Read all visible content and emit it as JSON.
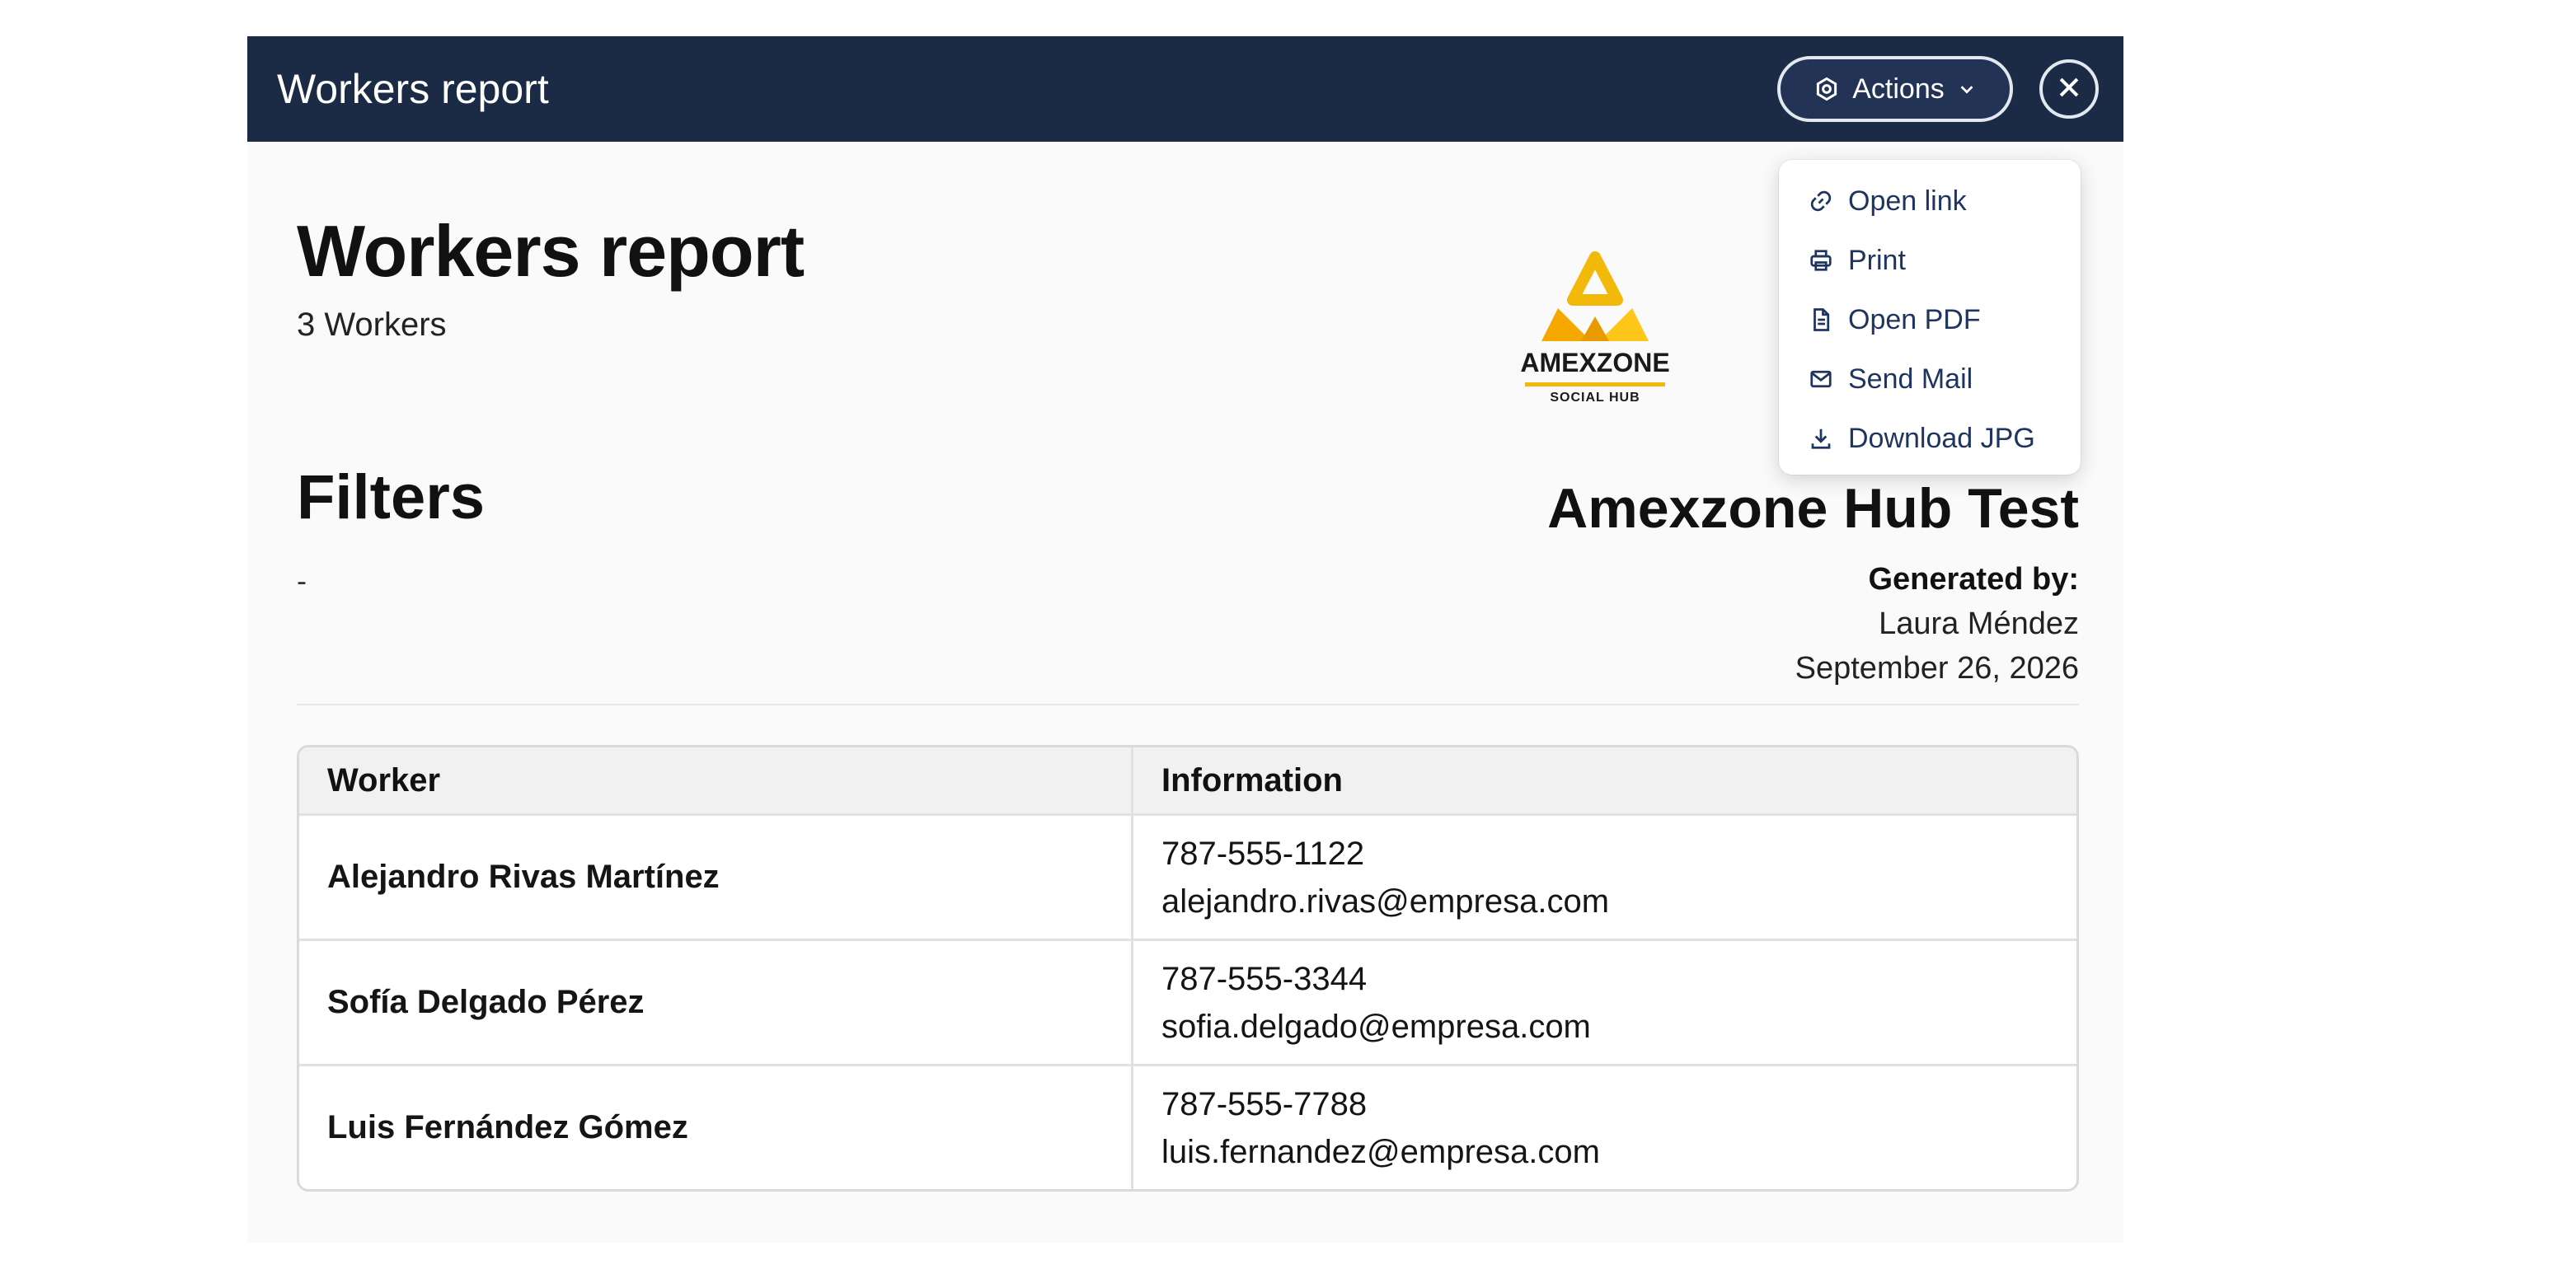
{
  "header": {
    "title": "Workers report",
    "actions_label": "Actions"
  },
  "actions_menu": {
    "items": [
      {
        "label": "Open link",
        "icon": "link-icon"
      },
      {
        "label": "Print",
        "icon": "printer-icon"
      },
      {
        "label": "Open PDF",
        "icon": "document-icon"
      },
      {
        "label": "Send Mail",
        "icon": "mail-icon"
      },
      {
        "label": "Download JPG",
        "icon": "download-icon"
      }
    ]
  },
  "report": {
    "title": "Workers report",
    "count": "3 Workers",
    "filters_title": "Filters",
    "filters_value": "-"
  },
  "logo": {
    "name": "AMEXZONE",
    "subtitle": "SOCIAL HUB"
  },
  "meta": {
    "hub_name": "Amexzone Hub Test",
    "generated_by_label": "Generated by:",
    "generated_by": "Laura Méndez",
    "date": "September 26, 2026"
  },
  "table": {
    "headers": [
      "Worker",
      "Information"
    ],
    "rows": [
      {
        "worker": "Alejandro Rivas Martínez",
        "phone": "787-555-1122",
        "email": "alejandro.rivas@empresa.com"
      },
      {
        "worker": "Sofía Delgado Pérez",
        "phone": "787-555-3344",
        "email": "sofia.delgado@empresa.com"
      },
      {
        "worker": "Luis Fernández Gómez",
        "phone": "787-555-7788",
        "email": "luis.fernandez@empresa.com"
      }
    ]
  },
  "colors": {
    "header_bg": "#1b2a45",
    "menu_text": "#1f3560",
    "logo_accent": "#f2b80a"
  }
}
